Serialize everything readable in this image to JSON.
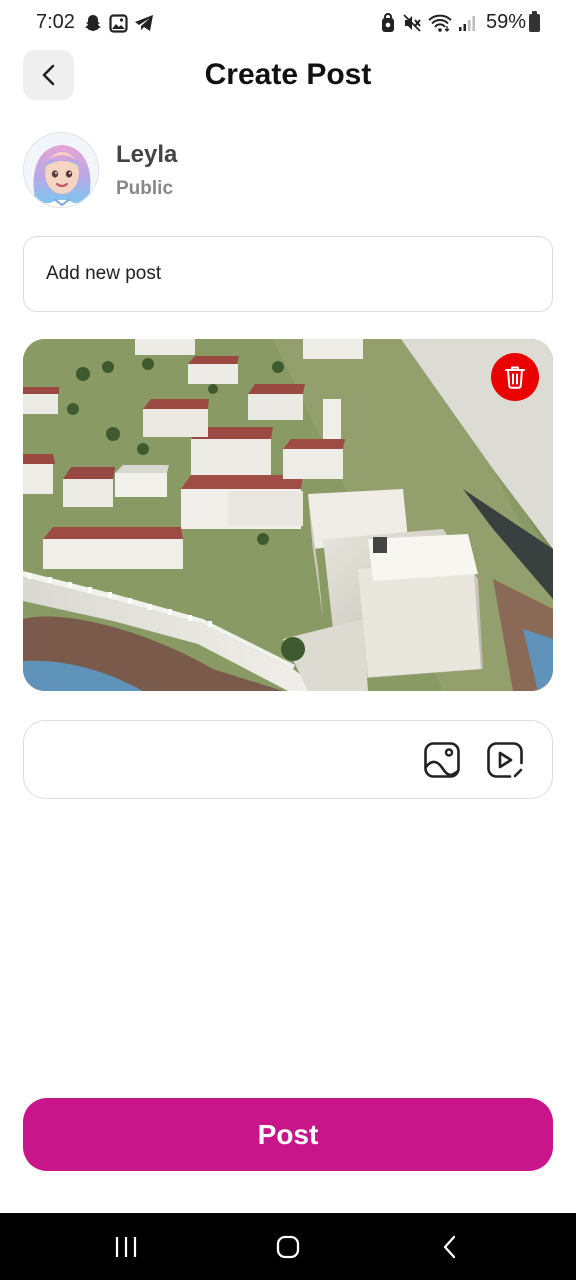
{
  "status_bar": {
    "time": "7:02",
    "battery_text": "59%",
    "left_icons": [
      "snapchat-icon",
      "gallery-icon",
      "telegram-icon"
    ],
    "right_icons": [
      "sync-icon",
      "mute-icon",
      "wifi-icon",
      "signal-icon",
      "battery-icon"
    ]
  },
  "header": {
    "title": "Create Post",
    "back_icon": "chevron-left-icon"
  },
  "user": {
    "name": "Leyla",
    "visibility": "Public"
  },
  "composer": {
    "placeholder": "Add new post",
    "value": ""
  },
  "media": {
    "delete_icon": "trash-icon"
  },
  "attachments": {
    "photo_icon": "image-icon",
    "video_icon": "video-icon"
  },
  "actions": {
    "post_label": "Post"
  },
  "colors": {
    "accent": "#c8168a",
    "delete": "#ea0000",
    "border": "#dcdcdc"
  },
  "nav_bar": {
    "items": [
      "recents-icon",
      "home-icon",
      "back-icon"
    ]
  }
}
